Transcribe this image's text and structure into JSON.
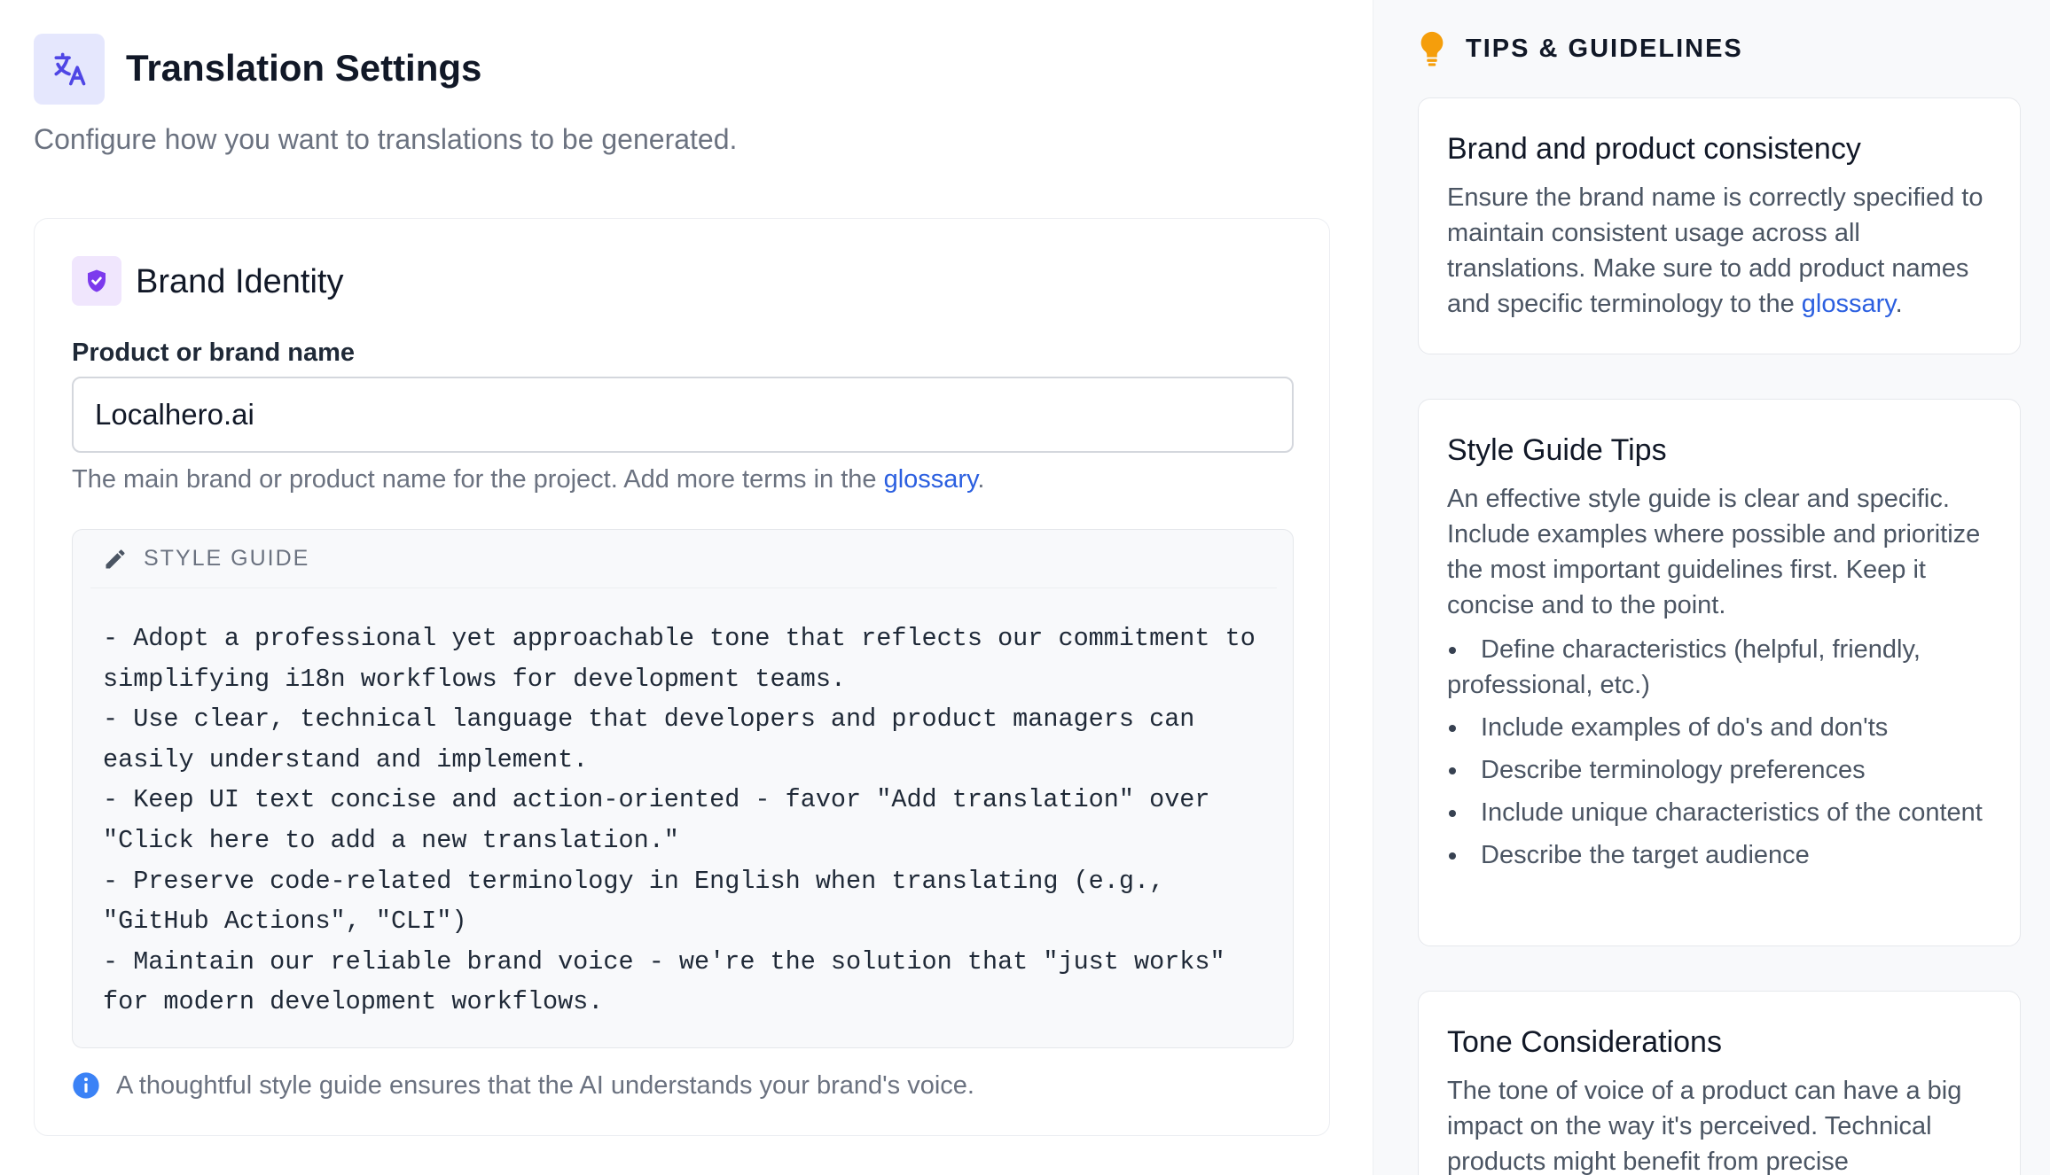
{
  "header": {
    "title": "Translation Settings",
    "subtitle": "Configure how you want to translations to be generated."
  },
  "brand_card": {
    "title": "Brand Identity",
    "field_label": "Product or brand name",
    "field_value": "Localhero.ai",
    "help_prefix": "The main brand or product name for the project. Add more terms in the ",
    "help_link": "glossary",
    "help_suffix": "."
  },
  "style_guide": {
    "label": "STYLE GUIDE",
    "text": "- Adopt a professional yet approachable tone that reflects our commitment to\nsimplifying i18n workflows for development teams.\n- Use clear, technical language that developers and product managers can\neasily understand and implement.\n- Keep UI text concise and action-oriented - favor \"Add translation\" over\n\"Click here to add a new translation.\"\n- Preserve code-related terminology in English when translating (e.g.,\n\"GitHub Actions\", \"CLI\")\n- Maintain our reliable brand voice - we're the solution that \"just works\"\nfor modern development workflows.",
    "info": "A thoughtful style guide ensures that the AI understands your brand's voice."
  },
  "sidebar": {
    "title": "TIPS & GUIDELINES",
    "cards": [
      {
        "title": "Brand and product consistency",
        "text_prefix": "Ensure the brand name is correctly specified to maintain consistent usage across all translations. Make sure to add product names and specific terminology to the ",
        "link": "glossary",
        "text_suffix": "."
      },
      {
        "title": "Style Guide Tips",
        "text": "An effective style guide is clear and specific. Include examples where possible and prioritize the most important guidelines first. Keep it concise and to the point.",
        "bullets": [
          "Define characteristics (helpful, friendly, professional, etc.)",
          "Include examples of do's and don'ts",
          "Describe terminology preferences",
          "Include unique characteristics of the content",
          "Describe the target audience"
        ]
      },
      {
        "title": "Tone Considerations",
        "text": "The tone of voice of a product can have a big impact on the way it's perceived. Technical products might benefit from precise"
      }
    ]
  },
  "colors": {
    "accent": "#4f46e5",
    "brand_icon": "#7c3aed",
    "link": "#2b5fe0",
    "tips_bulb": "#f59e0b",
    "info": "#3b82f6"
  },
  "icons": {
    "header": "translate-icon",
    "brand": "shield-check-icon",
    "style_guide": "pencil-icon",
    "info": "info-icon",
    "tips": "lightbulb-icon"
  }
}
